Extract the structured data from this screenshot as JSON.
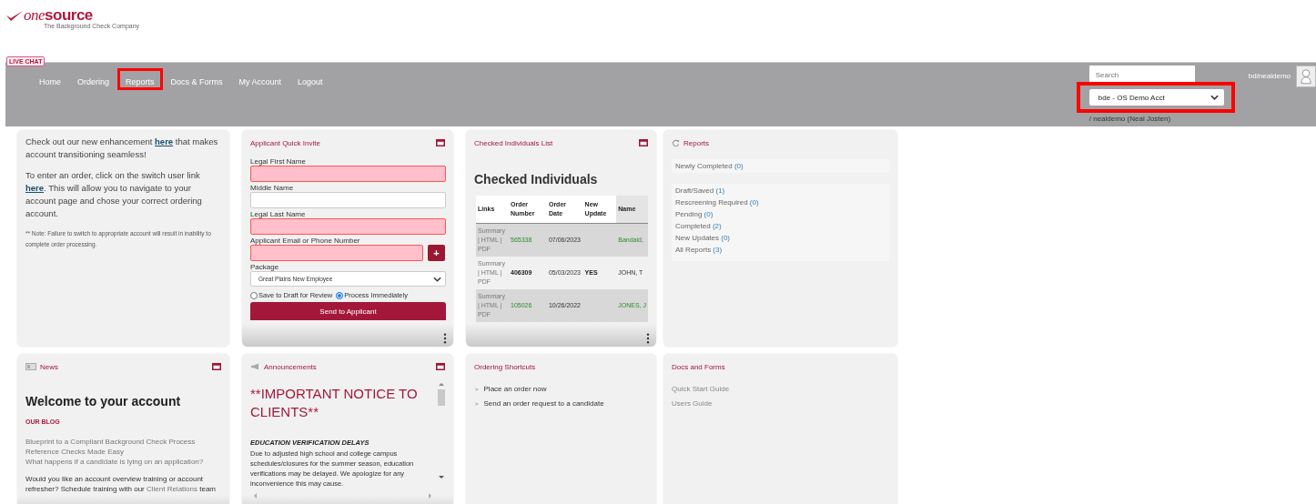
{
  "logo": {
    "name_first": "one",
    "name_second": "source",
    "tagline": "The Background Check Company"
  },
  "live_chat": "LIVE CHAT",
  "nav": [
    {
      "label": "Home",
      "highlighted": false
    },
    {
      "label": "Ordering",
      "highlighted": false
    },
    {
      "label": "Reports",
      "highlighted": true
    },
    {
      "label": "Docs & Forms",
      "highlighted": false
    },
    {
      "label": "My Account",
      "highlighted": false
    },
    {
      "label": "Logout",
      "highlighted": false
    }
  ],
  "header_right": {
    "search_placeholder": "Search",
    "username": "bd/nealdemo",
    "account_select": {
      "value": "bde - OS Demo Acct",
      "highlighted": true
    },
    "acting_as": "/ nealdemo (Neal Josten)"
  },
  "widgets": [
    {
      "kind": "notice",
      "overflowing": false,
      "paragraphs": [
        {
          "before": "Check out our new enhancement ",
          "link": "here",
          "after": " that makes account transitioning seamless!"
        },
        {
          "before": "To enter an order, click on the switch user link ",
          "link": "here",
          "after": ". This will allow you to navigate to your account page and chose your correct ordering account."
        }
      ],
      "note": "** Note: Failure to switch to appropriate account will result in inability to complete order processing."
    },
    {
      "kind": "quick_invite",
      "title": "Applicant Quick Invite",
      "collapsible": true,
      "overflowing": true,
      "fields": [
        {
          "label": "Legal First Name",
          "kind": "text",
          "required": true
        },
        {
          "label": "Middle Name",
          "kind": "text",
          "required": false
        },
        {
          "label": "Legal Last Name",
          "kind": "text",
          "required": true
        },
        {
          "label": "Applicant Email or Phone Number",
          "kind": "text_add",
          "required": true,
          "add_label": "+"
        },
        {
          "label": "Package",
          "kind": "select",
          "value": "Great Plains New Employee"
        }
      ],
      "options": [
        {
          "label": "Save to Draft for Review",
          "selected": false
        },
        {
          "label": "Process Immediately",
          "selected": true
        }
      ],
      "button": "Send to Applicant"
    },
    {
      "kind": "checked_list",
      "title": "Checked Individuals List",
      "collapsible": true,
      "overflowing": true,
      "heading": "Checked Individuals",
      "columns": [
        "Links",
        "Order Number",
        "Order Date",
        "New Update",
        "Name"
      ],
      "rows": [
        {
          "links": "Summary | HTML | PDF",
          "order_number": "565338",
          "order_date": "07/06/2023",
          "new_update": "",
          "name": "Bandaid,",
          "updated": false
        },
        {
          "links": "Summary | HTML | PDF",
          "order_number": "406309",
          "order_date": "05/03/2023",
          "new_update": "YES",
          "name": "JOHN, T",
          "updated": true
        },
        {
          "links": "Summary | HTML | PDF",
          "order_number": "105026",
          "order_date": "10/26/2022",
          "new_update": "",
          "name": "JONES, J",
          "updated": false
        }
      ]
    },
    {
      "kind": "reports",
      "title": "Reports",
      "collapsible": false,
      "overflowing": false,
      "groups": [
        [
          {
            "label": "Newly Completed",
            "count": "(0)"
          }
        ],
        [
          {
            "label": "Draft/Saved",
            "count": "(1)"
          },
          {
            "label": "Rescreening Required",
            "count": "(0)"
          },
          {
            "label": "Pending",
            "count": "(0)"
          },
          {
            "label": "Completed",
            "count": "(2)"
          },
          {
            "label": "New Updates",
            "count": "(0)"
          },
          {
            "label": "All Reports",
            "count": "(3)"
          }
        ]
      ]
    },
    {
      "kind": "news",
      "title": "News",
      "collapsible": true,
      "overflowing": true,
      "heading": "Welcome to your account",
      "blog_heading": "OUR BLOG",
      "blog_links": [
        "Blueprint to a Compliant Background Check Process",
        "Reference Checks Made Easy",
        "What happens if a candidate is lying on an application?"
      ],
      "paragraph": {
        "before": "Would you like an account overview training or account refresher? Schedule training with our ",
        "link": "Client Relations",
        "after": " team"
      }
    },
    {
      "kind": "announcements",
      "title": "Announcements",
      "collapsible": true,
      "overflowing": true,
      "heading": "**IMPORTANT NOTICE TO CLIENTS**",
      "subheading": "EDUCATION VERIFICATION DELAYS",
      "body": "Due to adjusted high school and college campus schedules/closures for the summer season, education verifications may be delayed. We apologize for any inconvenience this may cause."
    },
    {
      "kind": "shortcuts",
      "title": "Ordering Shortcuts",
      "collapsible": false,
      "overflowing": false,
      "items": [
        {
          "marker": ">",
          "label": "Place an order now"
        },
        {
          "marker": ">",
          "label": "Send an order request to a candidate"
        }
      ]
    },
    {
      "kind": "docs",
      "title": "Docs and Forms",
      "collapsible": false,
      "overflowing": false,
      "items": [
        "Quick Start Guide",
        "Users Guide"
      ]
    }
  ]
}
